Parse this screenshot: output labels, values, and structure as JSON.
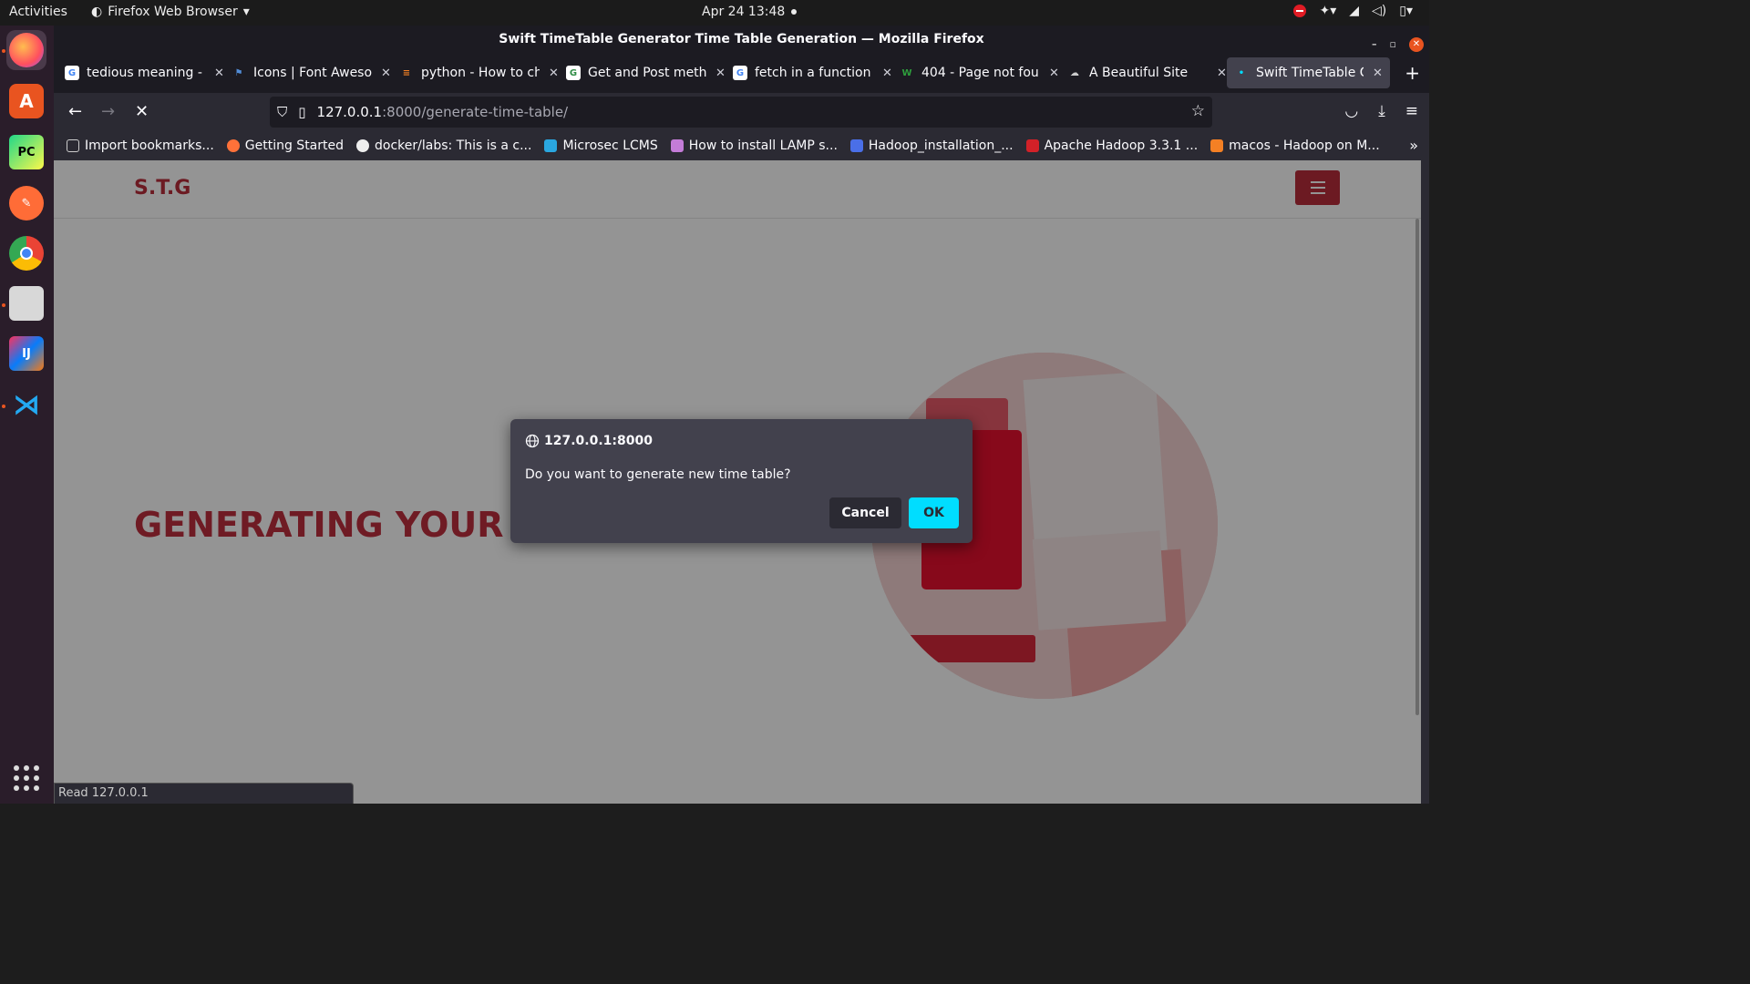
{
  "topbar": {
    "activities": "Activities",
    "app_name": "Firefox Web Browser",
    "clock": "Apr 24  13:48"
  },
  "window": {
    "title": "Swift TimeTable Generator Time Table Generation — Mozilla Firefox"
  },
  "tabs": [
    {
      "title": "tedious meaning -",
      "favicon": "google-icon",
      "color": "#4285f4"
    },
    {
      "title": "Icons | Font Aweso",
      "favicon": "flag-icon",
      "color": "#528dd7"
    },
    {
      "title": "python - How to ch",
      "favicon": "stackoverflow-icon",
      "color": "#f48024"
    },
    {
      "title": "Get and Post meth",
      "favicon": "gfg-icon",
      "color": "#2f8d46"
    },
    {
      "title": "fetch in a function",
      "favicon": "google-icon",
      "color": "#4285f4"
    },
    {
      "title": "404 - Page not fou",
      "favicon": "w-icon",
      "color": "#2e9e3c"
    },
    {
      "title": "A Beautiful Site",
      "favicon": "cloud-icon",
      "color": "#cccccc"
    },
    {
      "title": "Swift TimeTable G",
      "favicon": "loading-icon",
      "color": "#00ddff"
    }
  ],
  "url": {
    "host": "127.0.0.1",
    "path": ":8000/generate-time-table/"
  },
  "bookmarks": [
    {
      "label": "Import bookmarks...",
      "color": "#cccccc"
    },
    {
      "label": "Getting Started",
      "color": "#ff7139"
    },
    {
      "label": "docker/labs: This is a c...",
      "color": "#eeeeee"
    },
    {
      "label": "Microsec LCMS",
      "color": "#2aa7e0"
    },
    {
      "label": "How to install LAMP s...",
      "color": "#c47cd8"
    },
    {
      "label": "Hadoop_installation_...",
      "color": "#4a6fe8"
    },
    {
      "label": "Apache Hadoop 3.3.1 ...",
      "color": "#d22128"
    },
    {
      "label": "macos - Hadoop on M...",
      "color": "#f48024"
    }
  ],
  "site": {
    "brand": "S.T.G",
    "hero_title": "GENERATING YOUR TIME TABLE"
  },
  "dialog": {
    "origin": "127.0.0.1:8000",
    "message": "Do you want to generate new time table?",
    "cancel_label": "Cancel",
    "ok_label": "OK"
  },
  "status": {
    "text": "Read 127.0.0.1"
  },
  "colors": {
    "brand": "#bb2d3b",
    "ok_button": "#00ddff",
    "dock_bg": "#2a1d2a"
  }
}
